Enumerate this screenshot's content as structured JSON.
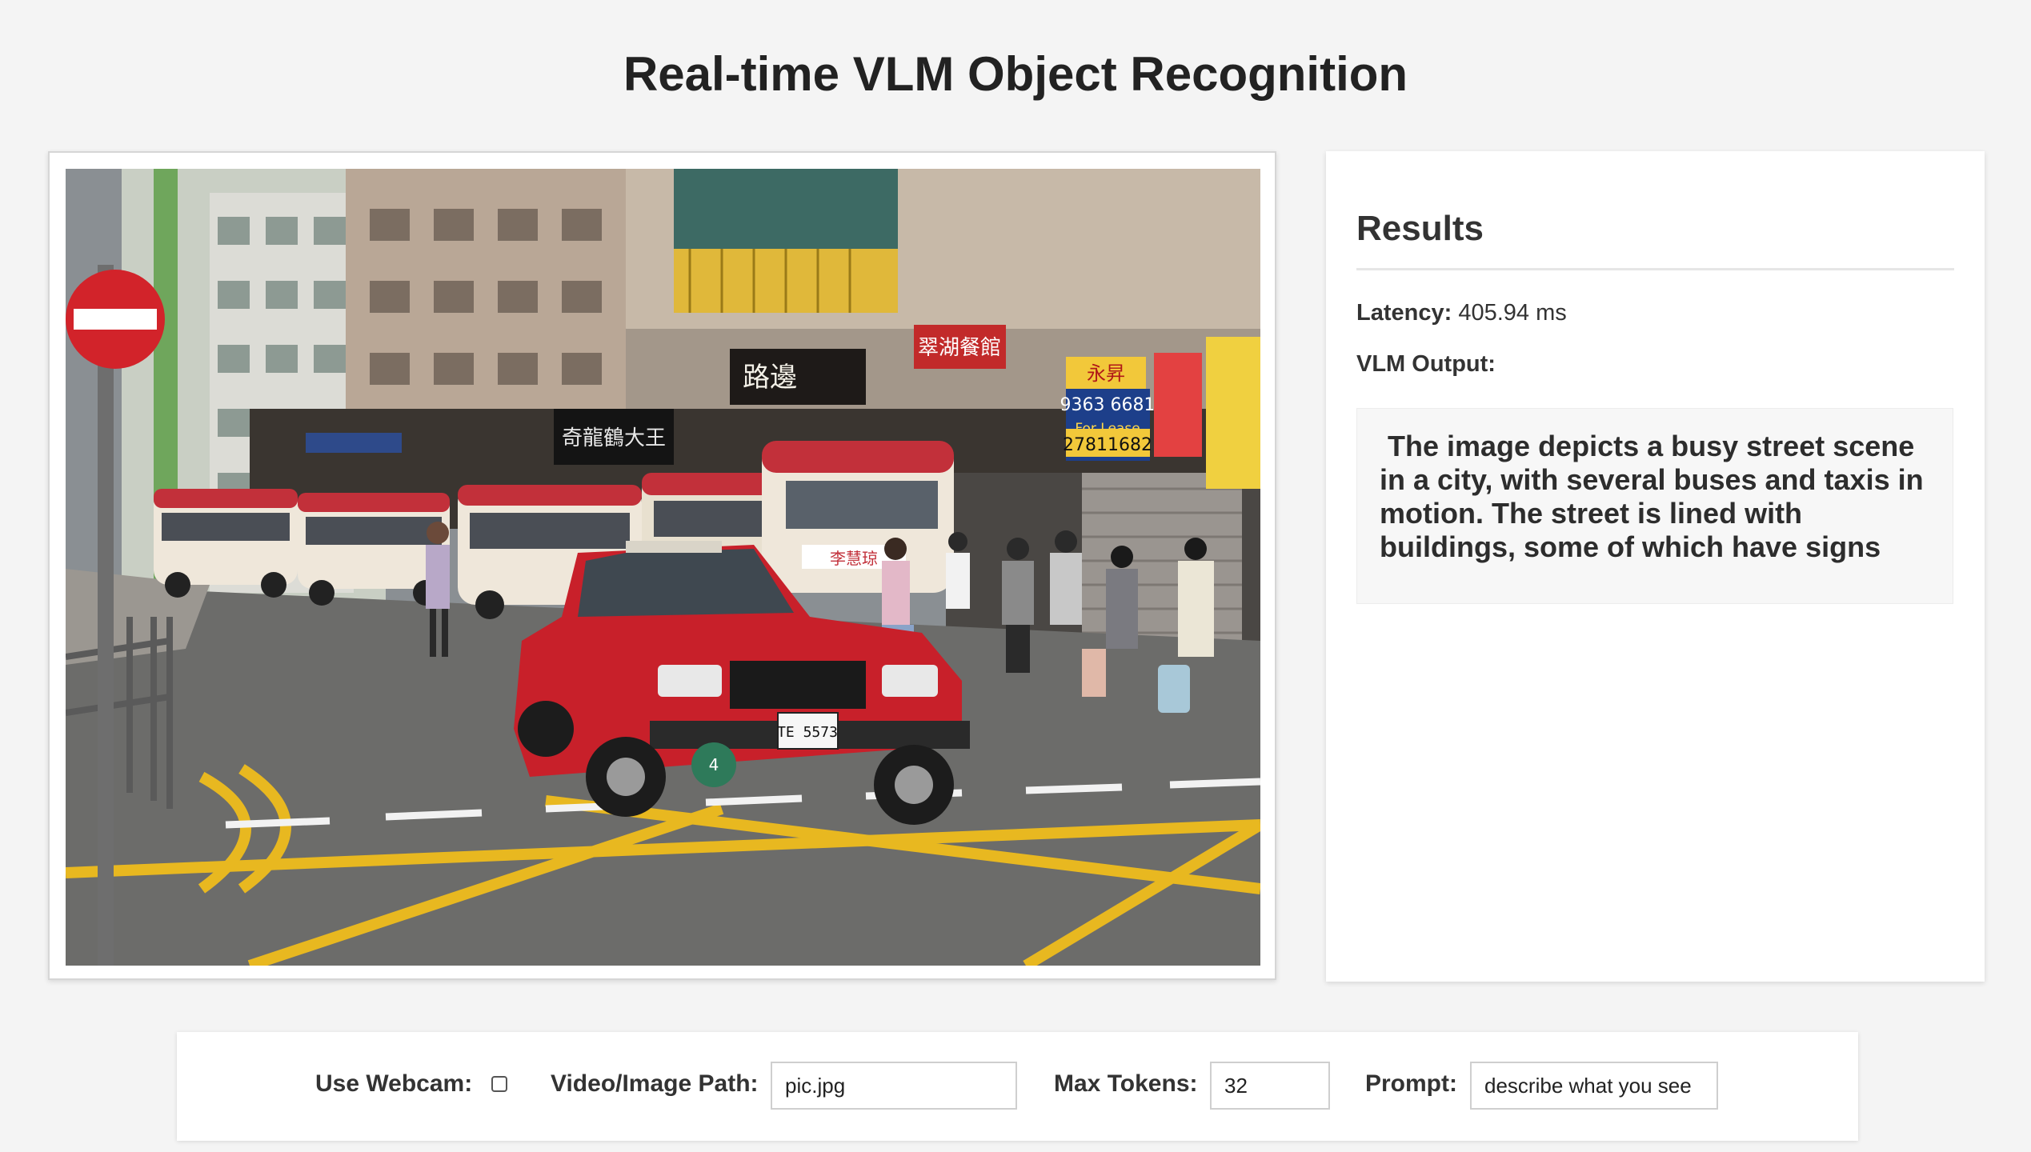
{
  "page": {
    "title": "Real-time VLM Object Recognition"
  },
  "image_panel": {
    "street_signs": {
      "shop_sign_1": "翠湖餐館",
      "shop_sign_2": "永昇",
      "phone_1": "9363 6681",
      "phone_2": "27811682",
      "for_lease": "For Lease",
      "shop_sign_3": "李慧琼",
      "shop_sign_4": "路邊",
      "shop_sign_5": "奇龍鶴大王",
      "plate": "TE 5573",
      "taxi_badge": "4"
    }
  },
  "results": {
    "title": "Results",
    "latency_label": "Latency:",
    "latency_value": "405.94 ms",
    "vlm_output_label": "VLM Output:",
    "vlm_output_text": " The image depicts a busy street scene in a city, with several buses and taxis in motion. The street is lined with buildings, some of which have signs"
  },
  "controls": {
    "webcam_label": "Use Webcam:",
    "webcam_checked": false,
    "path_label": "Video/Image Path:",
    "path_value": "pic.jpg",
    "max_tokens_label": "Max Tokens:",
    "max_tokens_value": "32",
    "prompt_label": "Prompt:",
    "prompt_value": "describe what you see"
  },
  "colors": {
    "background": "#f4f4f4",
    "card": "#ffffff",
    "taxi_red": "#c8202a",
    "road_yellow": "#e8b820"
  }
}
